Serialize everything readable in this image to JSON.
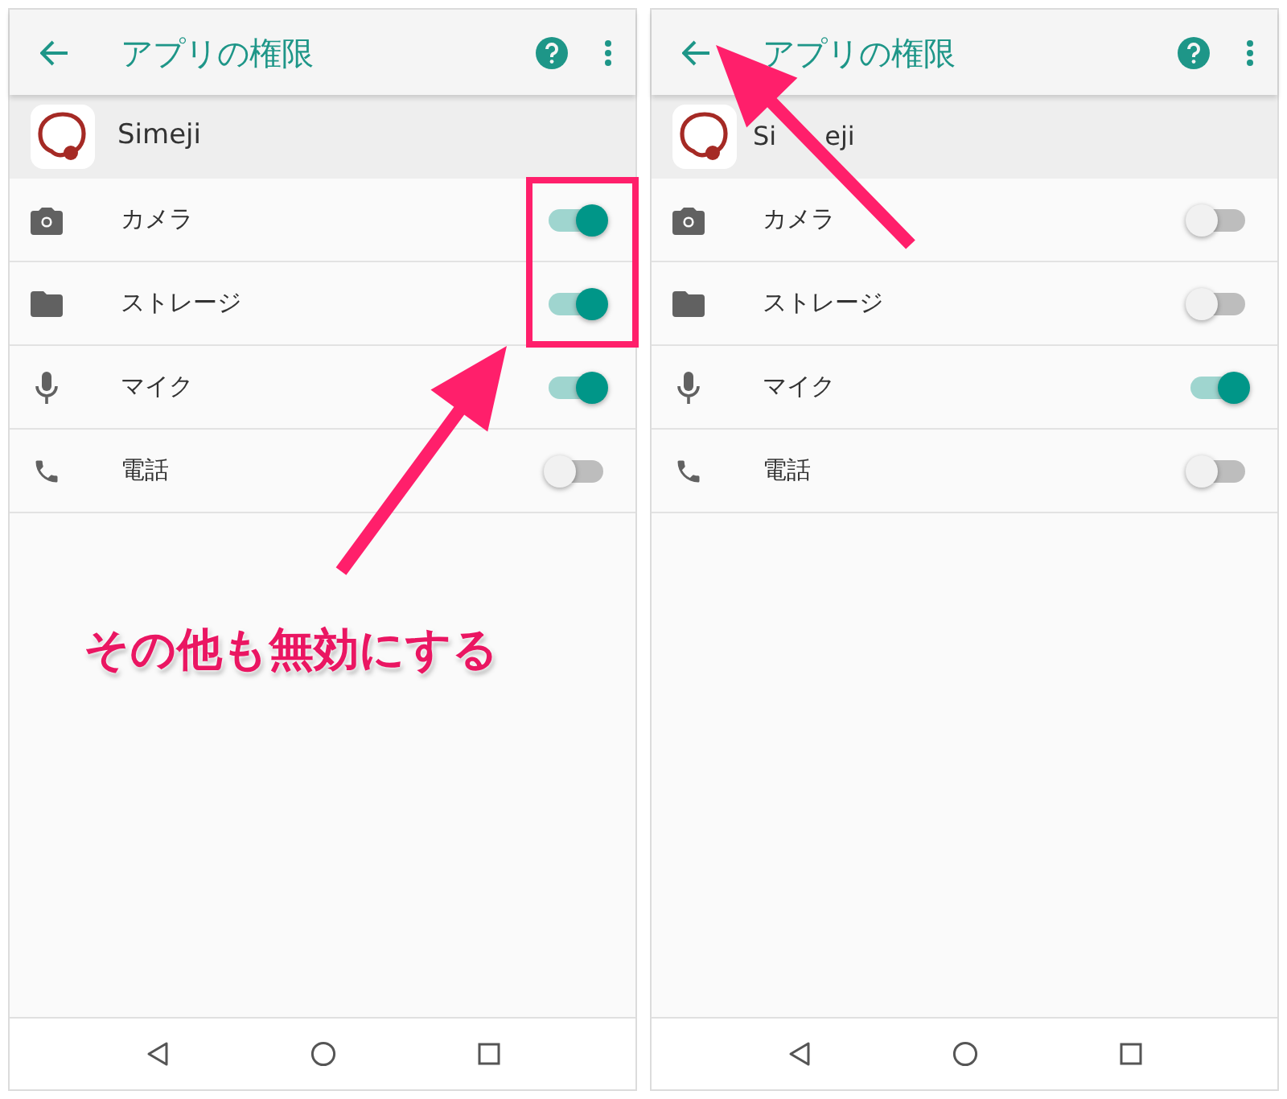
{
  "panels": [
    {
      "title": "アプリの権限",
      "app": {
        "name": "Simeji"
      },
      "permissions": [
        {
          "kind": "camera",
          "label": "カメラ",
          "on": true
        },
        {
          "kind": "folder",
          "label": "ストレージ",
          "on": true
        },
        {
          "kind": "mic",
          "label": "マイク",
          "on": true
        },
        {
          "kind": "phone",
          "label": "電話",
          "on": false
        }
      ]
    },
    {
      "title": "アプリの権限",
      "app": {
        "name_parts": [
          "Si",
          "eji"
        ]
      },
      "permissions": [
        {
          "kind": "camera",
          "label": "カメラ",
          "on": false
        },
        {
          "kind": "folder",
          "label": "ストレージ",
          "on": false
        },
        {
          "kind": "mic",
          "label": "マイク",
          "on": true
        },
        {
          "kind": "phone",
          "label": "電話",
          "on": false
        }
      ]
    }
  ],
  "annotations": [
    {
      "kind": "frame"
    },
    {
      "kind": "arrow"
    },
    {
      "kind": "caption",
      "text": "その他も無効にする"
    },
    {
      "kind": "arrow"
    }
  ]
}
